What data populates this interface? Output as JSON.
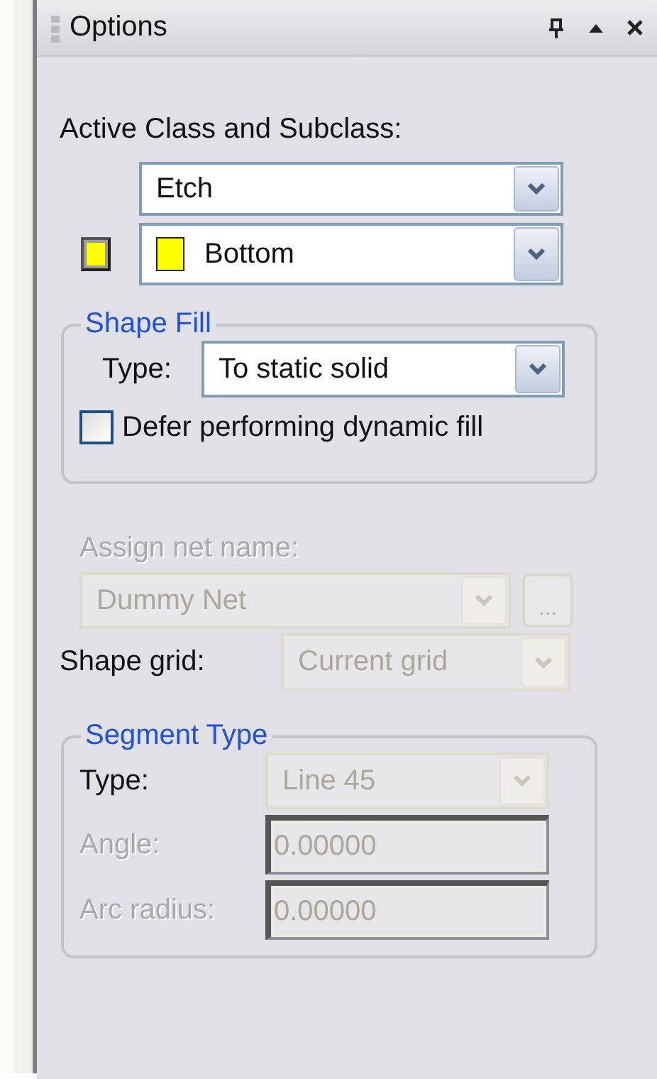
{
  "panel": {
    "title": "Options"
  },
  "active_class": {
    "label": "Active Class and Subclass:",
    "class_value": "Etch",
    "subclass_value": "Bottom",
    "color": "#ffff00"
  },
  "shape_fill": {
    "legend": "Shape Fill",
    "type_label": "Type:",
    "type_value": "To static solid",
    "defer": {
      "label": "Defer performing dynamic fill",
      "checked": false
    }
  },
  "net": {
    "label": "Assign net name:",
    "value": "Dummy Net",
    "browse": "...",
    "disabled": true
  },
  "shape_grid": {
    "label": "Shape grid:",
    "value": "Current grid",
    "disabled": true
  },
  "segment": {
    "legend": "Segment Type",
    "rows": [
      {
        "kind": "combo",
        "label": "Type:",
        "value": "Line 45",
        "label_disabled": false,
        "disabled": true
      },
      {
        "kind": "text",
        "label": "Angle:",
        "value": "0.00000",
        "label_disabled": true,
        "disabled": true
      },
      {
        "kind": "text",
        "label": "Arc radius:",
        "value": "0.00000",
        "label_disabled": true,
        "disabled": true
      }
    ]
  }
}
